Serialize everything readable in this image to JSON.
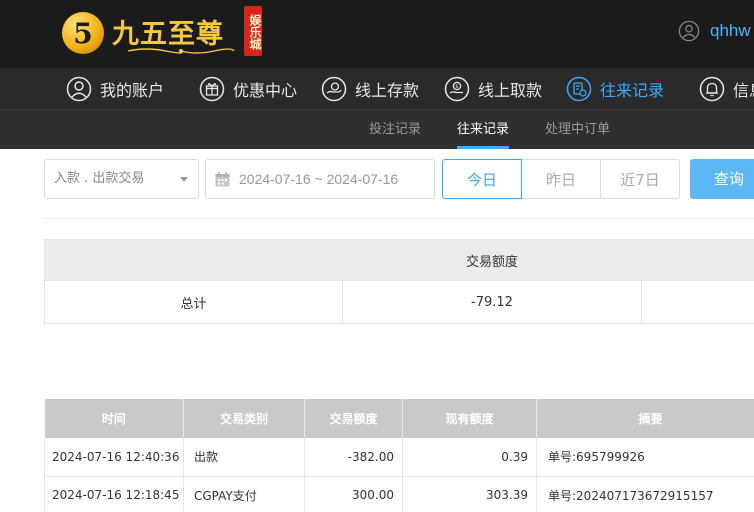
{
  "header": {
    "logo_mark": "5",
    "logo_text": "九五至尊",
    "logo_seal": "娱乐城",
    "username": "qhhw",
    "brand_color": "#f6c741",
    "accent_color": "#3ea8ff"
  },
  "nav": {
    "items": [
      {
        "label": "我的账户",
        "icon": "user-circle-icon"
      },
      {
        "label": "优惠中心",
        "icon": "gift-icon"
      },
      {
        "label": "线上存款",
        "icon": "deposit-icon"
      },
      {
        "label": "线上取款",
        "icon": "withdraw-icon"
      },
      {
        "label": "往来记录",
        "icon": "record-icon",
        "active": true
      },
      {
        "label": "信息",
        "icon": "bell-icon"
      }
    ]
  },
  "subnav": {
    "items": [
      {
        "label": "投注记录"
      },
      {
        "label": "往来记录",
        "active": true
      },
      {
        "label": "处理中订单"
      }
    ]
  },
  "filters": {
    "type_select": "入款 . 出款交易",
    "date_range": "2024-07-16 ~ 2024-07-16",
    "quick": [
      "今日",
      "昨日",
      "近7日"
    ],
    "quick_active": "今日",
    "query_label": "查询"
  },
  "summary": {
    "header": "交易额度",
    "label": "总计",
    "amount": "-79.12"
  },
  "records": {
    "columns": [
      "时间",
      "交易类别",
      "交易额度",
      "现有额度",
      "摘要"
    ],
    "rows": [
      [
        "2024-07-16 12:40:36",
        "出款",
        "-382.00",
        "0.39",
        "单号:695799926"
      ],
      [
        "2024-07-16 12:18:45",
        "CGPAY支付",
        "300.00",
        "303.39",
        "单号:202407173672915157"
      ]
    ]
  }
}
